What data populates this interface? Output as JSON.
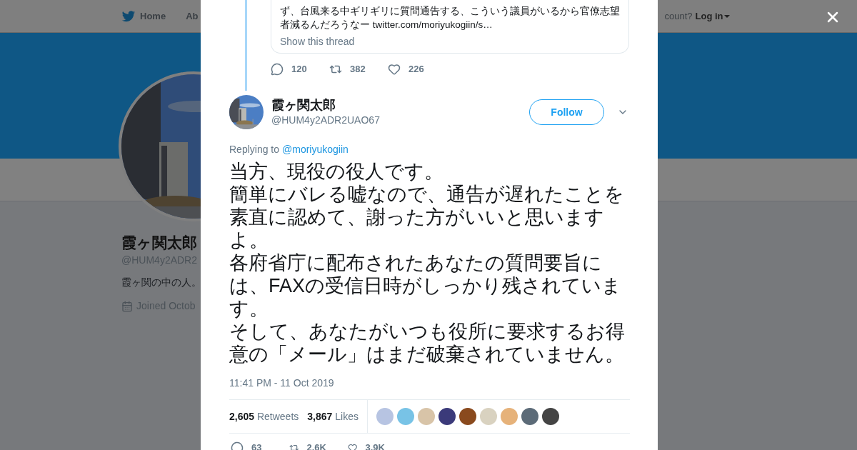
{
  "background_page": {
    "nav": {
      "items": [
        "Home",
        "Ab"
      ],
      "account_prompt": "count?",
      "login": "Log in"
    },
    "profile": {
      "name": "霞ヶ関太郎",
      "handle": "@HUM4y2ADR2",
      "bio": "霞ヶ関の中の人。",
      "joined": "Joined Octob"
    }
  },
  "thread": {
    "quoted_text": "ず、台風来る中ギリギリに質問通告する、こういう議員がいるから官僚志望者減るんだろうなー twitter.com/moriyukogiin/s…",
    "show_thread": "Show this thread",
    "actions": [
      {
        "kind": "reply",
        "count": "120"
      },
      {
        "kind": "retweet",
        "count": "382"
      },
      {
        "kind": "like",
        "count": "226"
      }
    ]
  },
  "tweet": {
    "name": "霞ヶ関太郎",
    "handle": "@HUM4y2ADR2UAO67",
    "follow": "Follow",
    "replying_label": "Replying to",
    "replying_to": "@moriyukogiin",
    "text_lines": [
      "当方、現役の役人です。",
      "簡単にバレる嘘なので、通告が遅れたことを素直に認めて、謝った方がいいと思いますよ。",
      "各府省庁に配布されたあなたの質問要旨には、FAXの受信日時がしっかり残されています。",
      "そして、あなたがいつも役所に要求するお得意の「メール」はまだ破棄されていません。"
    ],
    "timestamp": "11:41 PM - 11 Oct 2019",
    "stats": [
      {
        "count": "2,605",
        "label": "Retweets"
      },
      {
        "count": "3,867",
        "label": "Likes"
      }
    ],
    "actions": [
      {
        "kind": "reply",
        "count": "63"
      },
      {
        "kind": "retweet",
        "count": "2.6K"
      },
      {
        "kind": "like",
        "count": "3.9K"
      }
    ]
  }
}
